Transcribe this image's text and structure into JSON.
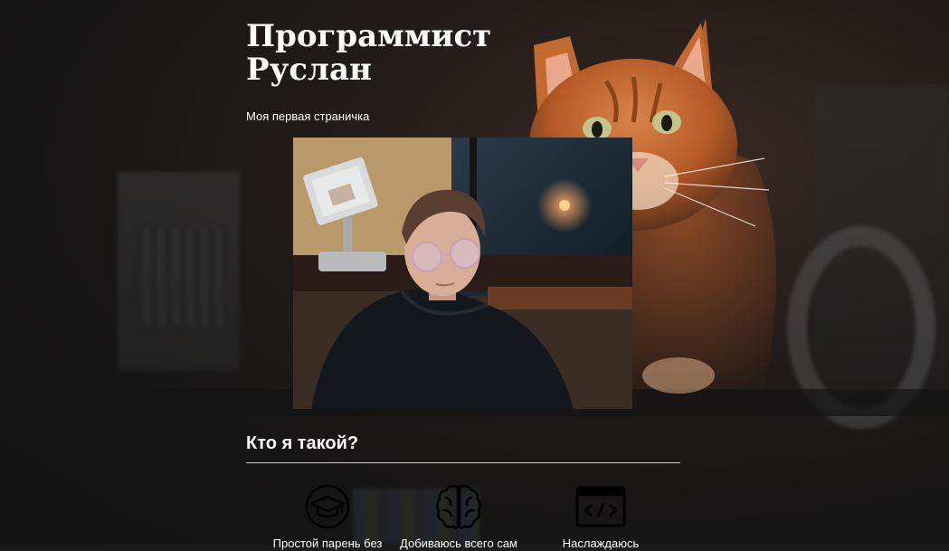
{
  "header": {
    "title": "Программист Руслан",
    "subtitle": "Моя первая страничка"
  },
  "about": {
    "heading": "Кто я такой?",
    "features": [
      {
        "icon": "graduation-cap-icon",
        "caption": "Простой парень без"
      },
      {
        "icon": "brain-icon",
        "caption": "Добиваюсь всего сам"
      },
      {
        "icon": "code-window-icon",
        "caption": "Наслаждаюсь"
      }
    ]
  },
  "colors": {
    "background": "#1b1b1c",
    "text": "#ffffff",
    "rule": "#cfcfcf",
    "cat_fur": "#c8692b"
  }
}
